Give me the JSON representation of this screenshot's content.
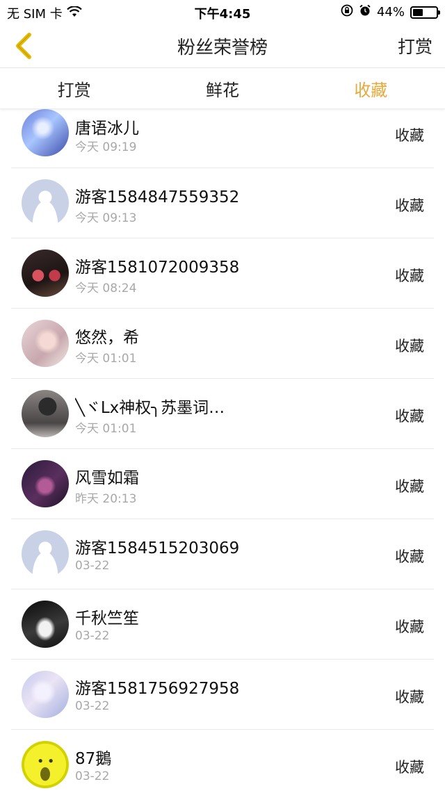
{
  "status_bar": {
    "carrier": "无 SIM 卡",
    "time": "下午4:45",
    "battery": "44%",
    "battery_level": 0.44,
    "icons": [
      "wifi-icon",
      "orientation-lock-icon",
      "alarm-icon",
      "battery-icon"
    ]
  },
  "nav": {
    "title": "粉丝荣誉榜",
    "right_label": "打赏",
    "back_icon": "chevron-left-icon",
    "accent_color": "#e6a93a"
  },
  "tabs": [
    {
      "label": "打赏",
      "active": false
    },
    {
      "label": "鲜花",
      "active": false
    },
    {
      "label": "收藏",
      "active": true
    }
  ],
  "list": [
    {
      "name": "唐语冰儿",
      "time": "今天 09:19",
      "action": "收藏",
      "avatar": "photo-blue"
    },
    {
      "name": "游客1584847559352",
      "time": "今天 09:13",
      "action": "收藏",
      "avatar": "default"
    },
    {
      "name": "游客1581072009358",
      "time": "今天 08:24",
      "action": "收藏",
      "avatar": "photo-red"
    },
    {
      "name": "悠然，希",
      "time": "今天 01:01",
      "action": "收藏",
      "avatar": "photo-pink"
    },
    {
      "name": "╲ヾLx神权╮苏墨词…",
      "time": "今天 01:01",
      "action": "收藏",
      "avatar": "photo-gray"
    },
    {
      "name": "风雪如霜",
      "time": "昨天 20:13",
      "action": "收藏",
      "avatar": "photo-purple"
    },
    {
      "name": "游客1584515203069",
      "time": "03-22",
      "action": "收藏",
      "avatar": "default"
    },
    {
      "name": "千秋竺笙",
      "time": "03-22",
      "action": "收藏",
      "avatar": "photo-dark"
    },
    {
      "name": "游客1581756927958",
      "time": "03-22",
      "action": "收藏",
      "avatar": "photo-light"
    },
    {
      "name": "87鵝",
      "time": "03-22",
      "action": "收藏",
      "avatar": "photo-yellow"
    }
  ]
}
